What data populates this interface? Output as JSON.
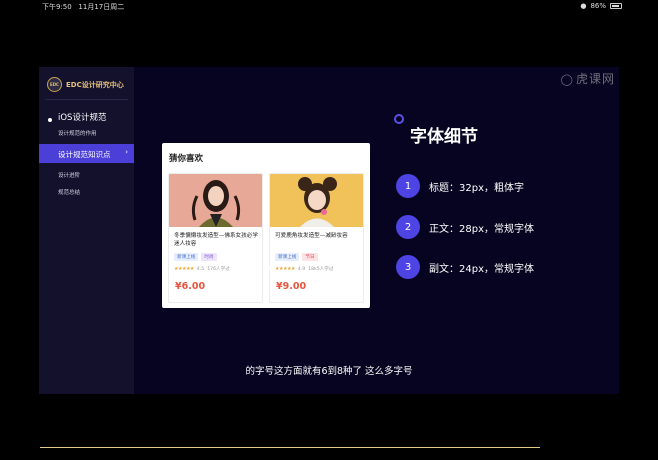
{
  "status_bar": {
    "time": "下午9:50",
    "date": "11月17日周二",
    "battery": "86%",
    "battery_level": 0.86
  },
  "sidebar": {
    "brand_logo_text": "EDC",
    "brand": "EDC设计研究中心",
    "groups": [
      {
        "title": "iOS设计规范",
        "subs": [
          "设计规范的作用"
        ]
      }
    ],
    "active_item": "设计规范知识点",
    "items_after": [
      "设计进阶",
      "规范总结"
    ]
  },
  "watermark": "虎课网",
  "card": {
    "title": "猜你喜欢",
    "products": [
      {
        "name": "冬季慵懒妆发造型—佛系女孩必学迷人妆容",
        "tags": [
          "新课上线",
          "时尚"
        ],
        "rating": "4.5",
        "learners": "176人学过",
        "price": "¥6.00"
      },
      {
        "name": "可爱鹿角妆发造型—减龄妆容",
        "tags": [
          "新课上线",
          "节日"
        ],
        "rating": "4.9",
        "learners": "18k5人学过",
        "price": "¥9.00"
      }
    ]
  },
  "content": {
    "heading": "字体细节",
    "specs": [
      {
        "num": "1",
        "text": "标题：32px，粗体字"
      },
      {
        "num": "2",
        "text": "正文：28px，常规字体"
      },
      {
        "num": "3",
        "text": "副文：24px，常规字体"
      }
    ]
  },
  "subtitle": "的字号这方面就有6到8种了 这么多字号",
  "colors": {
    "accent": "#4e44e4",
    "active_nav": "#4b3fd8",
    "price": "#e8533e",
    "brand_gold": "#e5c27a"
  }
}
